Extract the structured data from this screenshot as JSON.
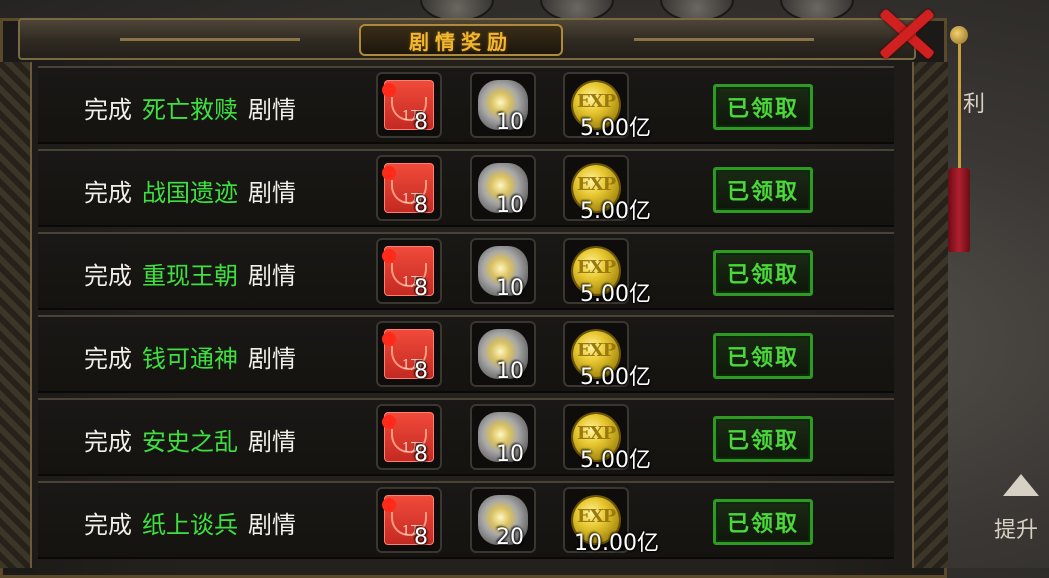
{
  "panel": {
    "title": "剧情奖励",
    "close_label": "×"
  },
  "side": {
    "partial_label": "利",
    "upgrade_label": "提升"
  },
  "rows": [
    {
      "prefix": "完成",
      "stage": "死亡救赎",
      "suffix": "剧情",
      "red_packet_label": "1万",
      "red_packet_qty": "8",
      "silver_qty": "10",
      "exp_label": "EXP",
      "exp_qty": "5.00亿",
      "button": "已领取"
    },
    {
      "prefix": "完成",
      "stage": "战国遗迹",
      "suffix": "剧情",
      "red_packet_label": "1万",
      "red_packet_qty": "8",
      "silver_qty": "10",
      "exp_label": "EXP",
      "exp_qty": "5.00亿",
      "button": "已领取"
    },
    {
      "prefix": "完成",
      "stage": "重现王朝",
      "suffix": "剧情",
      "red_packet_label": "1万",
      "red_packet_qty": "8",
      "silver_qty": "10",
      "exp_label": "EXP",
      "exp_qty": "5.00亿",
      "button": "已领取"
    },
    {
      "prefix": "完成",
      "stage": "钱可通神",
      "suffix": "剧情",
      "red_packet_label": "1万",
      "red_packet_qty": "8",
      "silver_qty": "10",
      "exp_label": "EXP",
      "exp_qty": "5.00亿",
      "button": "已领取"
    },
    {
      "prefix": "完成",
      "stage": "安史之乱",
      "suffix": "剧情",
      "red_packet_label": "1万",
      "red_packet_qty": "8",
      "silver_qty": "10",
      "exp_label": "EXP",
      "exp_qty": "5.00亿",
      "button": "已领取"
    },
    {
      "prefix": "完成",
      "stage": "纸上谈兵",
      "suffix": "剧情",
      "red_packet_label": "1万",
      "red_packet_qty": "8",
      "silver_qty": "20",
      "exp_label": "EXP",
      "exp_qty": "10.00亿",
      "button": "已领取"
    }
  ],
  "colors": {
    "stage_name": "#3ee040",
    "title": "#f0b830",
    "claimed_button": "#4ad83a",
    "close": "#d02020"
  },
  "icons": {
    "red_packet": "red-packet-icon",
    "silver": "silver-ore-icon",
    "exp": "exp-coin-icon",
    "close": "close-icon",
    "upgrade": "up-arrow-icon"
  }
}
